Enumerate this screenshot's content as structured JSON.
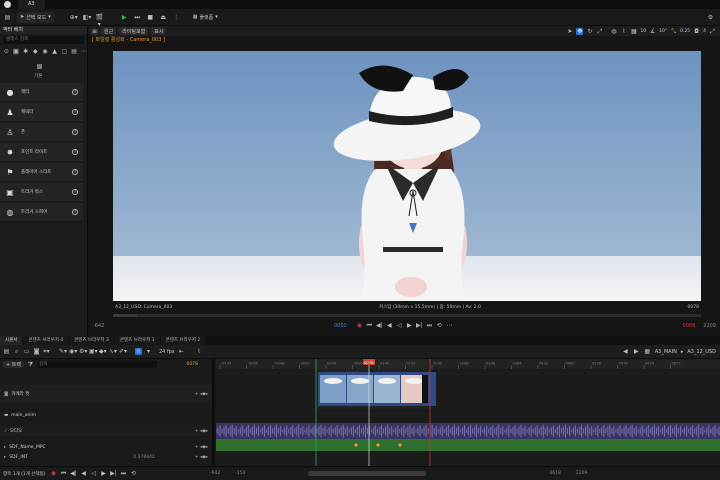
{
  "titlebar": {
    "tab": "A3"
  },
  "toolbar": {
    "mode_label": "선택 모드",
    "platform_label": "플랫폼"
  },
  "left_panel": {
    "header": "액터 배치",
    "search_placeholder": "클래스 검색",
    "category": "기본",
    "items": [
      {
        "label": "액터",
        "icon": "empty-actor-icon"
      },
      {
        "label": "캐릭터",
        "icon": "character-icon"
      },
      {
        "label": "폰",
        "icon": "pawn-icon"
      },
      {
        "label": "포인트 라이트",
        "icon": "point-light-icon"
      },
      {
        "label": "플레이어 스타트",
        "icon": "player-start-icon"
      },
      {
        "label": "트리거 박스",
        "icon": "trigger-box-icon"
      },
      {
        "label": "트리거 스피어",
        "icon": "trigger-sphere-icon"
      }
    ]
  },
  "viewport": {
    "buttons": [
      "원근",
      "라이팅포함",
      "표시"
    ],
    "title": "[ 파일럿 활성화 - Camera_003 ]",
    "right_tools": {
      "grid_snap": "10",
      "angle_snap": "10°",
      "scale_snap": "0.25",
      "camera_speed": "4"
    },
    "info_left": "A3_12_USD: Camera_003",
    "info_center": "커스텀 (30mm x 15.5mm) | 줌: 50mm | Av: 2.0",
    "info_right": "0078",
    "range_start": "-642",
    "range_end": "2209",
    "marker_left": "0000",
    "marker_right": "0088"
  },
  "sequencer": {
    "tabs": [
      "시퀀서",
      "콘텐츠 브라우저 4",
      "콘텐츠 브라우저 3",
      "콘텐츠 브라우저 1",
      "콘텐츠 브라우저 2"
    ],
    "add_track": "+ 트랙",
    "search_placeholder": "검색",
    "current_frame": "0078",
    "fps": "24 fps",
    "breadcrumb": [
      "A3_MAIN",
      "A3_12_USD"
    ],
    "tracks": [
      {
        "label": "카메라 컷",
        "type": "camera-cut"
      },
      {
        "label": "main_anim",
        "type": "folder"
      },
      {
        "label": "오디오",
        "type": "audio"
      },
      {
        "label": "SDF_Name_MPC",
        "type": "param"
      },
      {
        "label": "SDF_INT",
        "type": "param",
        "value": "0.378842"
      }
    ],
    "ticks": [
      "-0144",
      "-0096",
      "-0048",
      "0000",
      "0048",
      "0096",
      "0144",
      "0192",
      "0240",
      "0288",
      "0336",
      "0384",
      "0432",
      "0480",
      "0528",
      "0576",
      "0624",
      "0672"
    ],
    "status_text": "항목 1개 (1개 선택됨)",
    "range_start": "-642",
    "range_in": "-154",
    "range_out": "0618",
    "range_end": "2209"
  }
}
